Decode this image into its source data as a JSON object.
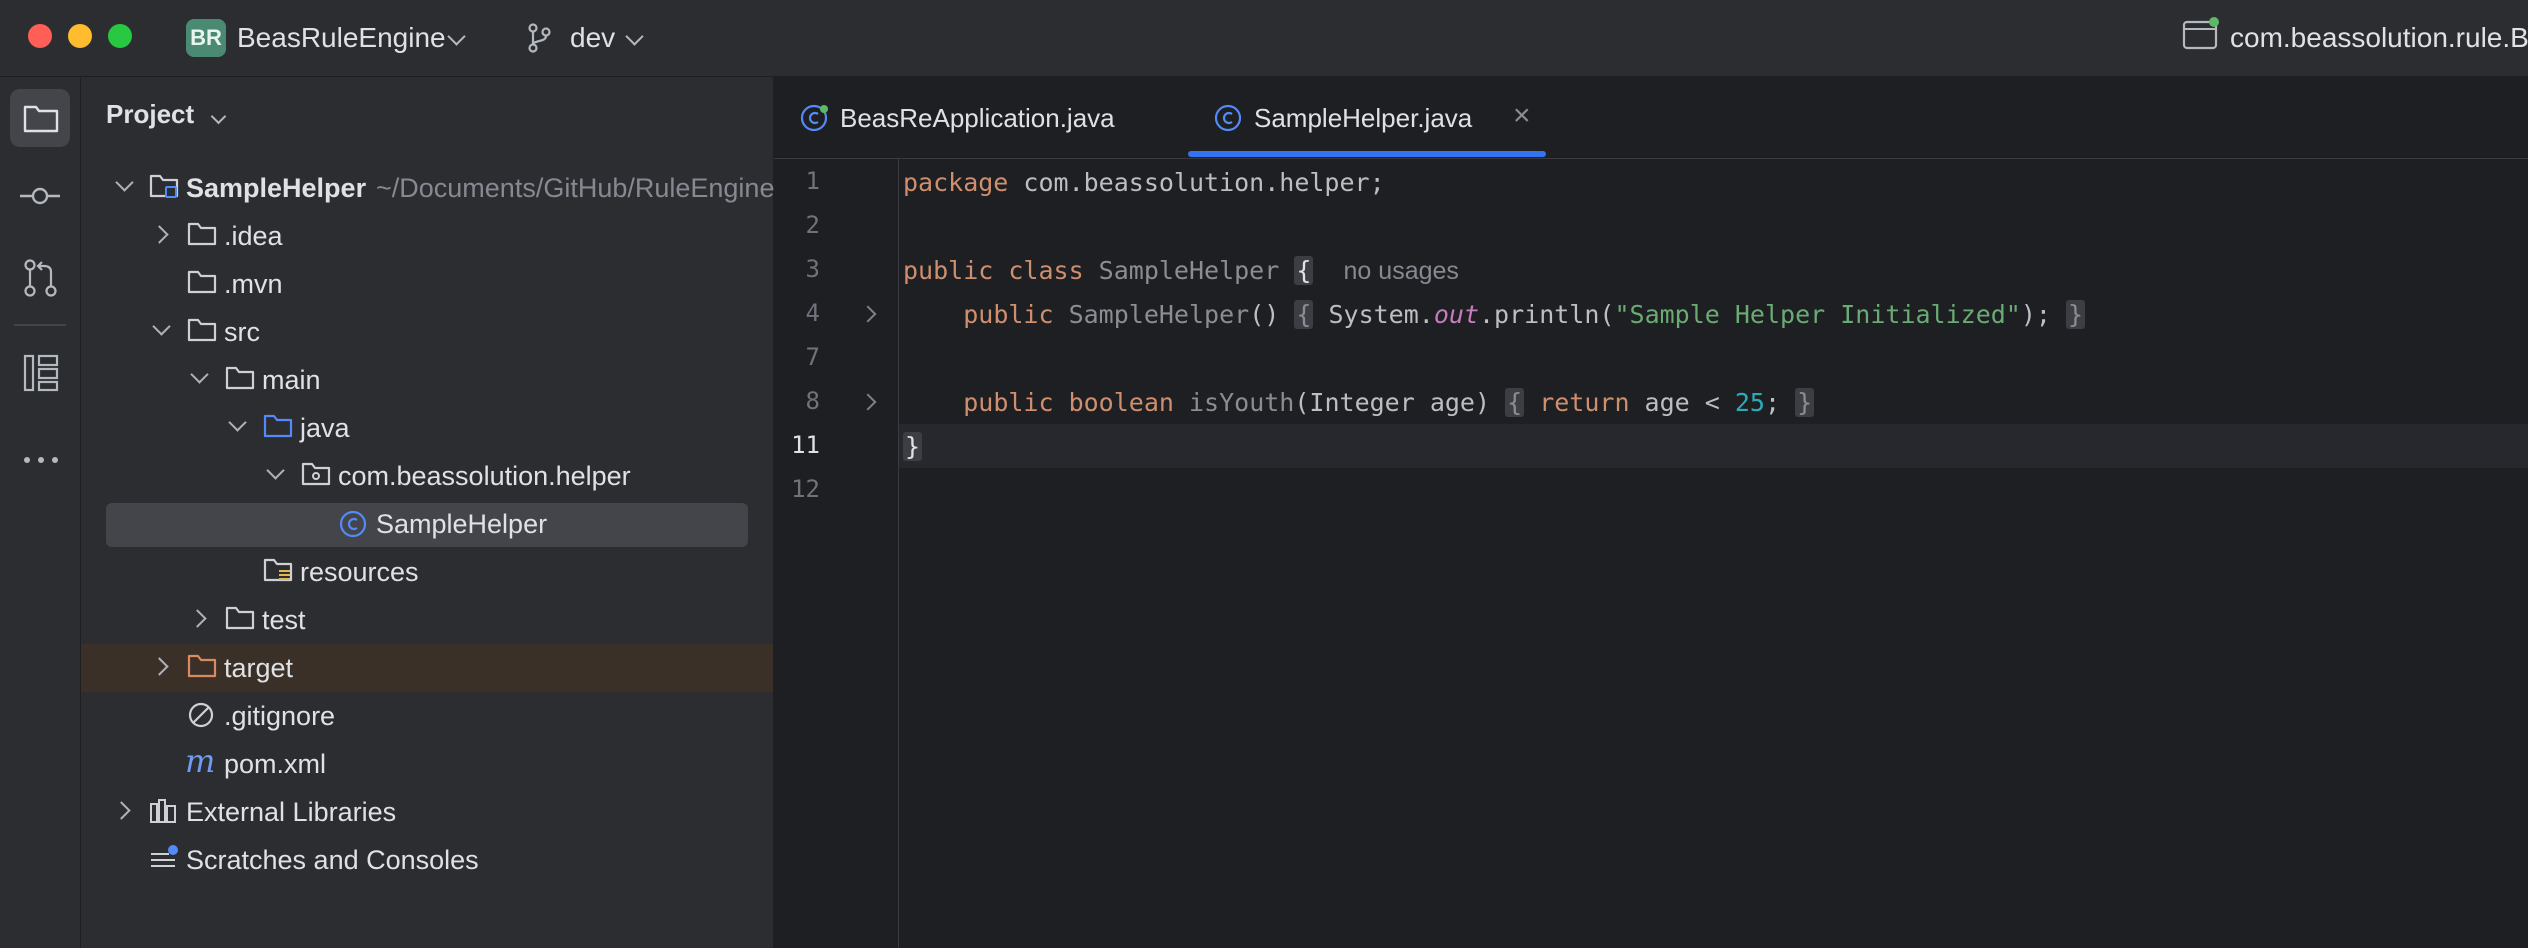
{
  "titlebar": {
    "project_badge": "BR",
    "project_name": "BeasRuleEngine",
    "branch": "dev",
    "run_config": "com.beassolution.rule.Be",
    "traffic_colors": [
      "#ff5f57",
      "#febc2e",
      "#28c840"
    ]
  },
  "toolstrip": {
    "tools": [
      "folder-icon",
      "commit-icon",
      "pull-requests-icon",
      "structure-icon",
      "more-icon"
    ]
  },
  "project_panel": {
    "title": "Project",
    "tree": [
      {
        "label": "SampleHelper",
        "suffix": "~/Documents/GitHub/RuleEngine",
        "icon": "module-folder-icon",
        "expanded": true
      },
      {
        "label": ".idea",
        "icon": "folder-icon",
        "expanded": false
      },
      {
        "label": ".mvn",
        "icon": "folder-icon"
      },
      {
        "label": "src",
        "icon": "folder-icon",
        "expanded": true
      },
      {
        "label": "main",
        "icon": "folder-icon",
        "expanded": true
      },
      {
        "label": "java",
        "icon": "source-folder-icon",
        "expanded": true
      },
      {
        "label": "com.beassolution.helper",
        "icon": "package-icon",
        "expanded": true
      },
      {
        "label": "SampleHelper",
        "icon": "class-icon",
        "selected": true
      },
      {
        "label": "resources",
        "icon": "resources-folder-icon"
      },
      {
        "label": "test",
        "icon": "folder-icon",
        "expanded": false
      },
      {
        "label": "target",
        "icon": "excluded-folder-icon",
        "expanded": false
      },
      {
        "label": ".gitignore",
        "icon": "ignore-file-icon"
      },
      {
        "label": "pom.xml",
        "icon": "maven-icon"
      },
      {
        "label": "External Libraries",
        "icon": "libraries-icon",
        "expanded": false
      },
      {
        "label": "Scratches and Consoles",
        "icon": "scratches-icon"
      }
    ]
  },
  "editor": {
    "tabs": [
      {
        "label": "BeasReApplication.java",
        "active": false
      },
      {
        "label": "SampleHelper.java",
        "active": true,
        "close": "×"
      }
    ],
    "line_numbers": [
      "1",
      "2",
      "3",
      "4",
      "7",
      "8",
      "11",
      "12"
    ],
    "current_line": "11",
    "code": {
      "l1_kw": "package",
      "l1_rest": " com.beassolution.helper;",
      "l3_kw": "public class ",
      "l3_cls": "SampleHelper",
      "l3_brace": "{",
      "l3_hint": "no usages",
      "l4_kw": "public ",
      "l4_cls": "SampleHelper",
      "l4_paren": "() ",
      "l4_ob": "{",
      "l4_sys": " System.",
      "l4_out": "out",
      "l4_call": ".println(",
      "l4_str": "\"Sample Helper Initialized\"",
      "l4_end": "); ",
      "l4_cb": "}",
      "l8_kw": "public boolean ",
      "l8_method": "isYouth",
      "l8_args": "(Integer age) ",
      "l8_ob": "{",
      "l8_ret": " return",
      "l8_mid": " age < ",
      "l8_num": "25",
      "l8_semi": "; ",
      "l8_cb": "}",
      "l11": "}"
    }
  }
}
